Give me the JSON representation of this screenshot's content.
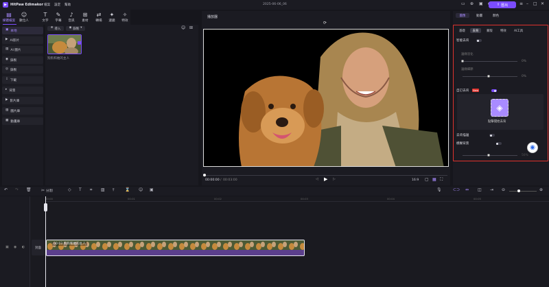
{
  "app": {
    "name": "HitPaw Edimakor",
    "project_title": "2025-06-06_06"
  },
  "menus": [
    "檔案",
    "設定",
    "幫助"
  ],
  "export_label": "匯出",
  "toolbar": [
    {
      "icon": "folder-icon",
      "label": "媒體檔案"
    },
    {
      "icon": "avatar-icon",
      "label": "數位人"
    },
    {
      "icon": "text-icon",
      "label": "文字"
    },
    {
      "icon": "caption-icon",
      "label": "字幕"
    },
    {
      "icon": "audio-icon",
      "label": "音訊"
    },
    {
      "icon": "material-icon",
      "label": "素材"
    },
    {
      "icon": "transition-icon",
      "label": "轉場"
    },
    {
      "icon": "filter-icon",
      "label": "濾鏡"
    },
    {
      "icon": "effects-icon",
      "label": "特效"
    }
  ],
  "left_tabs": [
    {
      "icon": "folder-icon",
      "label": "本地",
      "active": true
    },
    {
      "icon": "ai-video-icon",
      "label": "AI影片"
    },
    {
      "icon": "ai-image-icon",
      "label": "AI 圖片"
    },
    {
      "icon": "record-icon",
      "label": "錄製"
    },
    {
      "icon": "record-screen-icon",
      "label": "錄製"
    },
    {
      "icon": "download-icon",
      "label": "下載"
    },
    {
      "icon": "background-icon",
      "label": "背景"
    },
    {
      "icon": "video-library-icon",
      "label": "影片庫"
    },
    {
      "icon": "image-library-icon",
      "label": "圖片庫"
    },
    {
      "icon": "animation-library-icon",
      "label": "動畫庫"
    }
  ],
  "media": {
    "import_label": "導入",
    "record_label": "錄製",
    "item_name": "狗狗和她的主人"
  },
  "player": {
    "title": "播放器",
    "current_time": "00:00:00",
    "total_time": "00:03:00",
    "aspect": "16:9",
    "progress": 0
  },
  "props": {
    "top_tabs": [
      "圖像",
      "動畫",
      "顏色"
    ],
    "sub_tabs": [
      "基礎",
      "去背",
      "蒙版",
      "特效",
      "AI工具"
    ],
    "smart_bg_removal": "智能去背",
    "edge_softness": "邊緣羽化",
    "edge_smooth": "邊緣細節",
    "pct1": "0%",
    "pct2": "0%",
    "custom_bg_removal": "自訂去背",
    "custom_badge": "New",
    "click_to_start": "點擊開始去背",
    "remove_bg_label": "去背描邊",
    "blur_bg_label": "模糊背景",
    "blur_value": "50%"
  },
  "timeline": {
    "split_label": "分割",
    "track_label": "封面",
    "clip_label": "00:03 狗狗和她的主人",
    "ruler": [
      "00:00",
      "00:01",
      "00:02",
      "00:03",
      "00:04",
      "00:05"
    ],
    "zoom": 0.35
  },
  "colors": {
    "accent": "#7b4cff",
    "highlight_border": "#e0322d",
    "clip": "#5b3f8c"
  }
}
